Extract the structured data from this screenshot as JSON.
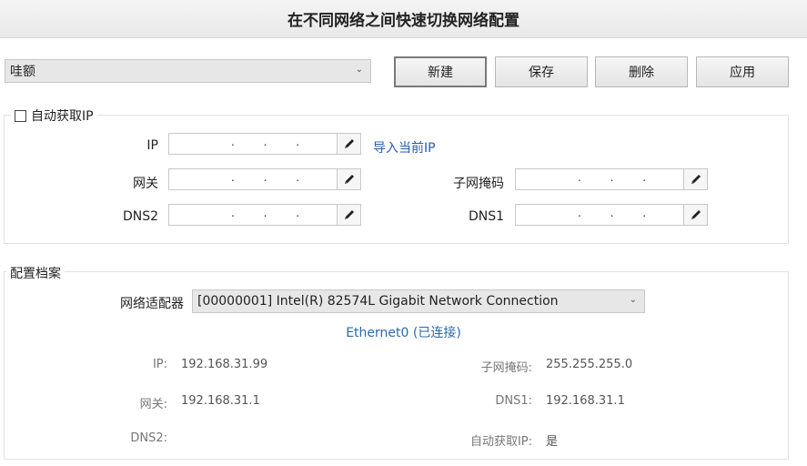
{
  "window": {
    "title": "在不同网络之间快速切换网络配置"
  },
  "toolbar": {
    "profile_value": "哇额",
    "new_label": "新建",
    "save_label": "保存",
    "delete_label": "删除",
    "apply_label": "应用"
  },
  "ip_group": {
    "auto_ip_label": "自动获取IP",
    "auto_ip_checked": false,
    "ip_label": "IP",
    "gateway_label": "网关",
    "dns2_label": "DNS2",
    "subnet_label": "子网掩码",
    "dns1_label": "DNS1",
    "ip_dots": ". . .",
    "import_label": "导入当前IP"
  },
  "profile_group": {
    "title": "配置档案",
    "adapter_label": "网络适配器",
    "adapter_value": "[00000001] Intel(R) 82574L Gigabit Network Connection",
    "adapter_status": "Ethernet0 (已连接)",
    "ip_label": "IP:",
    "ip_value": "192.168.31.99",
    "subnet_label": "子网掩码:",
    "subnet_value": "255.255.255.0",
    "gateway_label": "网关:",
    "gateway_value": "192.168.31.1",
    "dns1_label": "DNS1:",
    "dns1_value": "192.168.31.1",
    "dns2_label": "DNS2:",
    "dns2_value": "",
    "auto_label": "自动获取IP:",
    "auto_value": "是"
  },
  "icons": {
    "edit": "pencil-icon",
    "dropdown": "chevron-down-icon"
  }
}
